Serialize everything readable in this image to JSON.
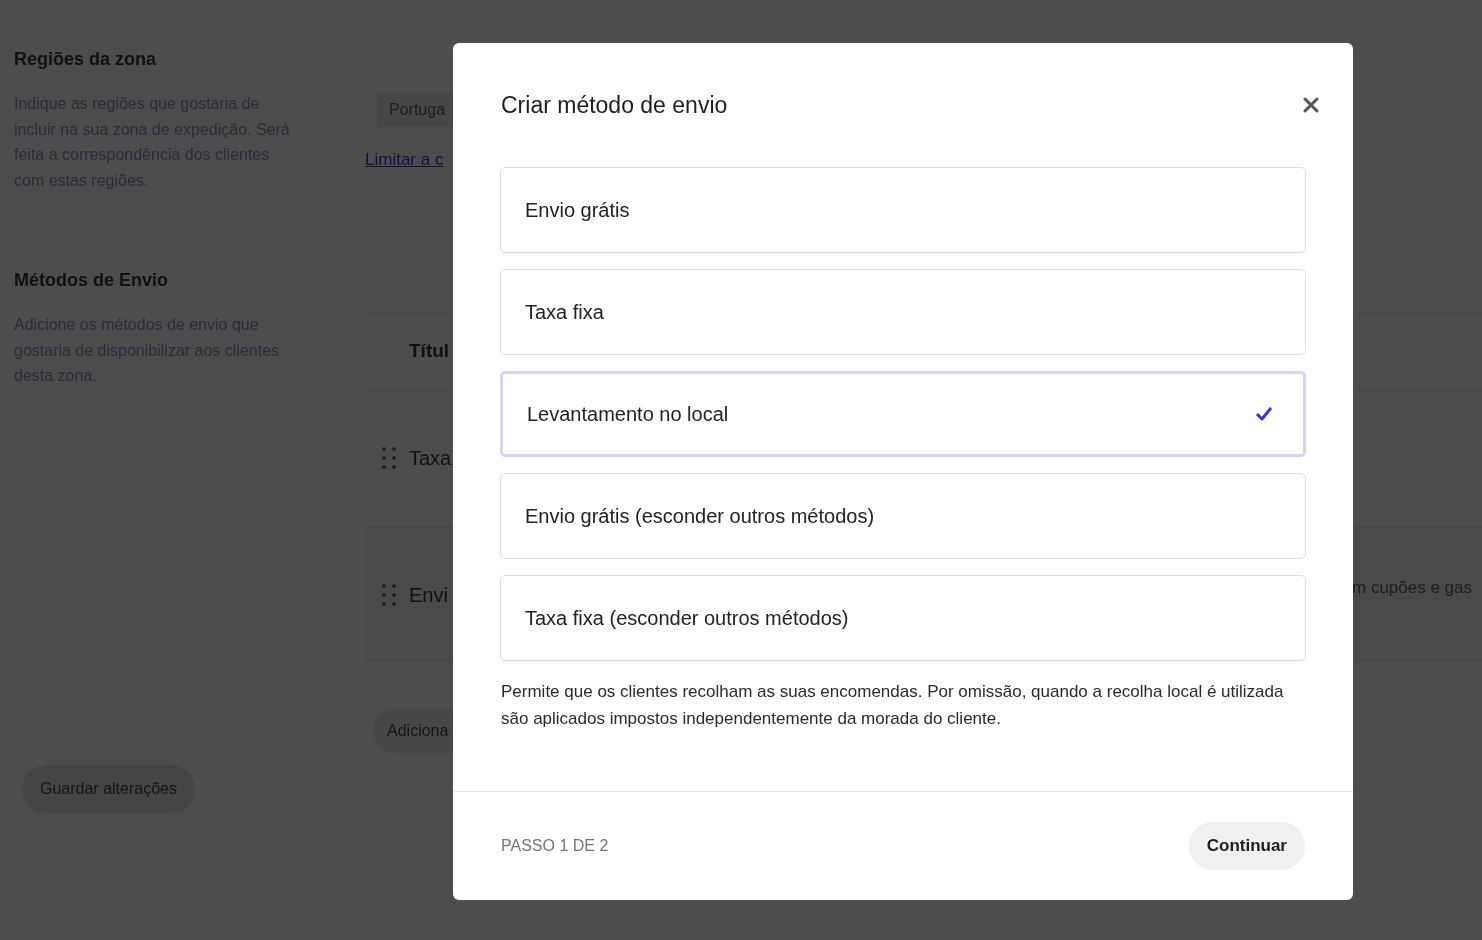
{
  "background": {
    "sections": [
      {
        "title": "Regiões da zona",
        "description": "Indique as regiões que gostaria de incluir na sua zona de expedição. Será feita a correspondência dos clientes com estas regiões."
      },
      {
        "title": "Métodos de Envio",
        "description": "Adicione os métodos de envio que gostaria de disponibilizar aos clientes desta zona."
      }
    ],
    "region_field": {
      "value": "Portuga"
    },
    "link": "Limitar a c",
    "table": {
      "column_header": "Títul",
      "rows": [
        {
          "title": "Taxa"
        },
        {
          "title": "Envi",
          "column_3": "m cupões e gas"
        }
      ]
    },
    "add_button": "Adiciona",
    "save_button": "Guardar alterações"
  },
  "modal": {
    "title": "Criar método de envio",
    "options": [
      {
        "label": "Envio grátis",
        "selected": false
      },
      {
        "label": "Taxa fixa",
        "selected": false
      },
      {
        "label": "Levantamento no local",
        "selected": true
      },
      {
        "label": "Envio grátis (esconder outros métodos)",
        "selected": false
      },
      {
        "label": "Taxa fixa (esconder outros métodos)",
        "selected": false
      }
    ],
    "description": "Permite que os clientes recolham as suas encomendas. Por omissão, quando a recolha local é utilizada são aplicados impostos independentemente da morada do cliente.",
    "step": "PASSO 1 DE 2",
    "continue_button": "Continuar"
  }
}
